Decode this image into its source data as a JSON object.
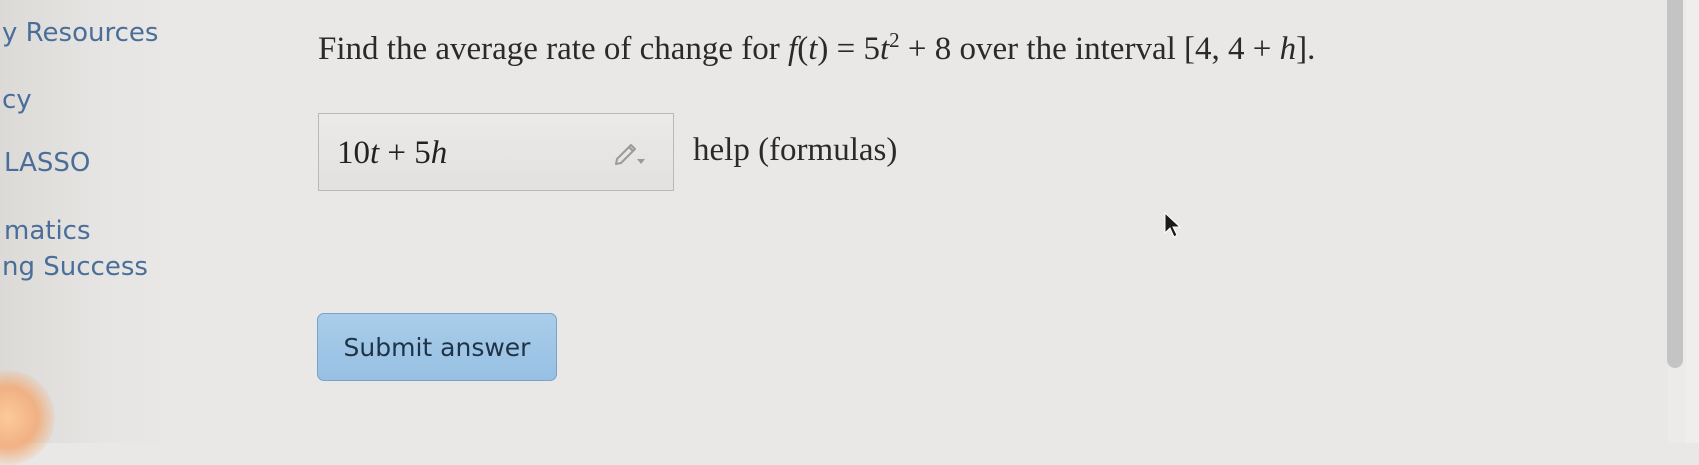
{
  "sidebar": {
    "items": [
      {
        "label": "y Resources"
      },
      {
        "label": "cy"
      },
      {
        "label": "LASSO"
      },
      {
        "label": "matics"
      },
      {
        "label": "ng Success"
      }
    ]
  },
  "question": {
    "prefix": "Find the average rate of change for ",
    "fn": "f",
    "open_paren": "(",
    "var_t": "t",
    "eq": ") = 5",
    "var_t2": "t",
    "exp": "2",
    "plus8": " + 8 over the interval [4, 4 + ",
    "var_h": "h",
    "suffix": "]."
  },
  "answer": {
    "lead": "10",
    "var_t": "t",
    "mid": " + 5",
    "var_h": "h"
  },
  "help_label": "help (formulas)",
  "submit_label": "Submit answer",
  "colors": {
    "link": "#4a6e99",
    "button": "#a9cdea",
    "background": "#e9e8e6"
  },
  "icons": {
    "answer_tool": "pencil-icon",
    "mouse": "cursor-icon"
  }
}
